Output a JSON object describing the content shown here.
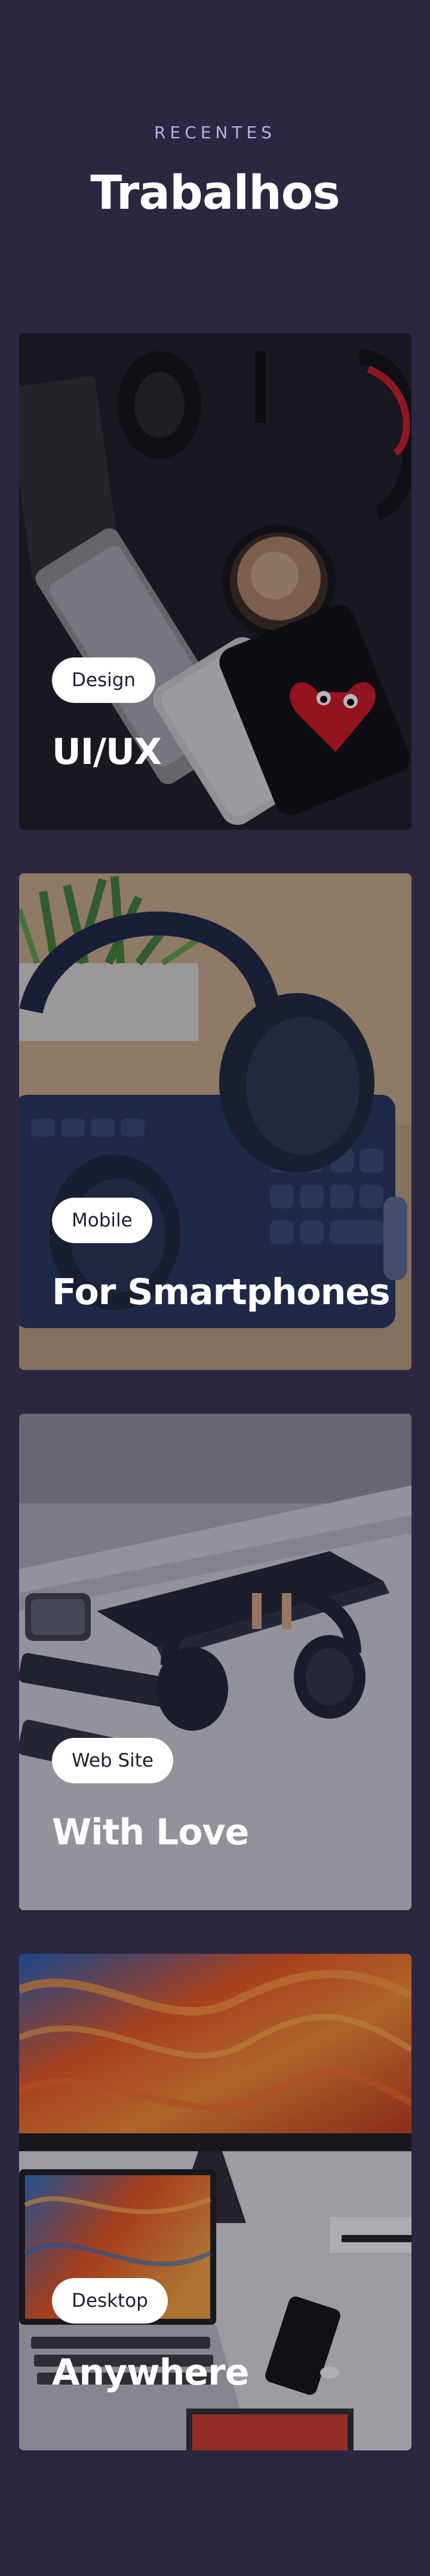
{
  "section": {
    "eyebrow": "RECENTES",
    "title": "Trabalhos"
  },
  "projects": [
    {
      "tag": "Design",
      "title": "UI/UX",
      "image": "desk-flatlay-photo"
    },
    {
      "tag": "Mobile",
      "title": "For Smartphones",
      "image": "headphones-keyboard-photo"
    },
    {
      "tag": "Web Site",
      "title": "With Love",
      "image": "headphones-desk-photo"
    },
    {
      "tag": "Desktop",
      "title": "Anywhere",
      "image": "monitor-laptop-photo"
    }
  ],
  "colors": {
    "background": "#2c2641",
    "eyebrow": "#b7b0e8",
    "title": "#ffffff",
    "tag_bg": "#ffffff",
    "tag_text": "#1f1c33"
  }
}
